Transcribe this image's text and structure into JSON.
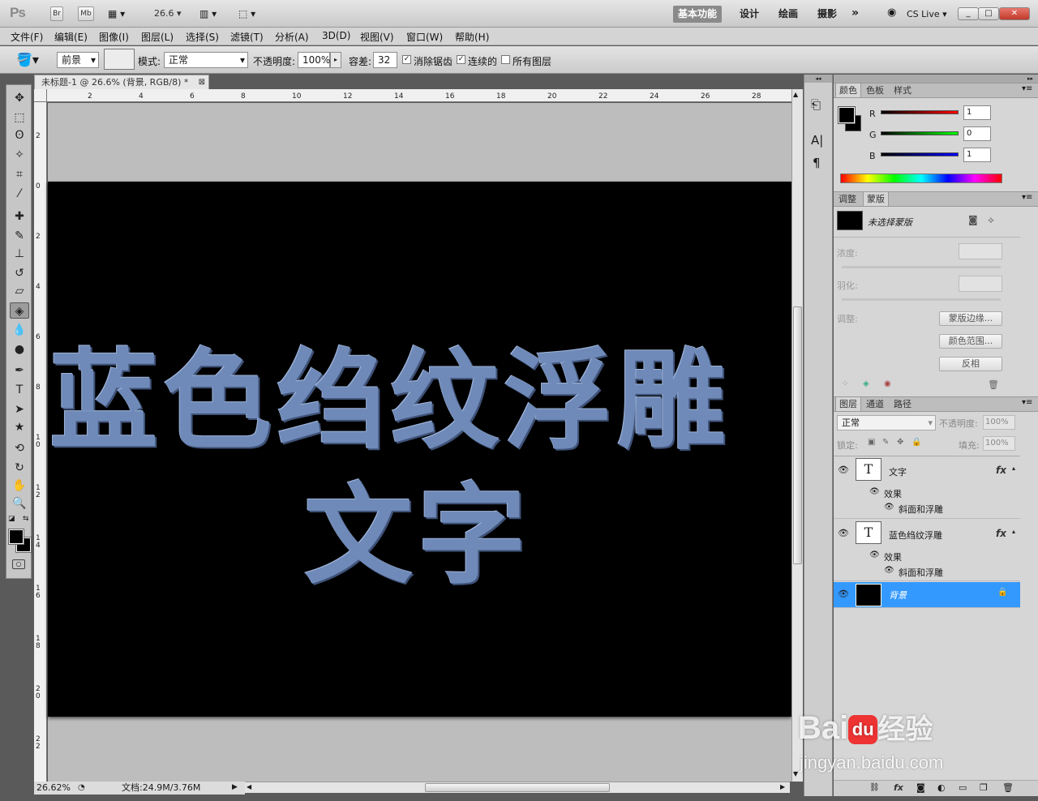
{
  "app": {
    "logo": "Ps",
    "bridge": "Br",
    "minibridge": "Mb",
    "zoom": "26.6"
  },
  "workspaces": [
    "基本功能",
    "设计",
    "绘画",
    "摄影"
  ],
  "cs_live": "CS Live",
  "window_controls": [
    "_",
    "□",
    "✕"
  ],
  "menu": [
    "文件(F)",
    "编辑(E)",
    "图像(I)",
    "图层(L)",
    "选择(S)",
    "滤镜(T)",
    "分析(A)",
    "3D(D)",
    "视图(V)",
    "窗口(W)",
    "帮助(H)"
  ],
  "options": {
    "fill_source": "前景",
    "mode_label": "模式:",
    "mode_value": "正常",
    "opacity_label": "不透明度:",
    "opacity_value": "100%",
    "tolerance_label": "容差:",
    "tolerance_value": "32",
    "antialias_label": "消除锯齿",
    "contiguous_label": "连续的",
    "all_layers_label": "所有图层"
  },
  "document": {
    "tab_title": "未标题-1 @ 26.6% (背景, RGB/8) *",
    "canvas_line1": "蓝色绉纹浮雕",
    "canvas_line2": "文字",
    "ruler_h": [
      "2",
      "4",
      "6",
      "8",
      "10",
      "12",
      "14",
      "16",
      "18",
      "20",
      "22",
      "24",
      "26",
      "28"
    ],
    "ruler_v": [
      "2",
      "0",
      "2",
      "4",
      "6",
      "8",
      "1 0",
      "1 2",
      "1 4",
      "1 6",
      "1 8",
      "2 0",
      "2 2"
    ],
    "zoom_status": "26.62%",
    "doc_size": "文档:24.9M/3.76M"
  },
  "color_panel": {
    "tabs": [
      "颜色",
      "色板",
      "样式"
    ],
    "r_label": "R",
    "g_label": "G",
    "b_label": "B",
    "r_value": "1",
    "g_value": "0",
    "b_value": "1"
  },
  "masks_panel": {
    "tabs": [
      "调整",
      "蒙版"
    ],
    "title": "未选择蒙版",
    "density_label": "浓度:",
    "feather_label": "羽化:",
    "refine_label": "调整:",
    "btn_mask_edge": "蒙版边缘...",
    "btn_color_range": "颜色范围...",
    "btn_invert": "反相"
  },
  "layers_panel": {
    "tabs": [
      "图层",
      "通道",
      "路径"
    ],
    "blend_mode": "正常",
    "opacity_label": "不透明度:",
    "opacity_value": "100%",
    "lock_label": "锁定:",
    "fill_label": "填充:",
    "fill_value": "100%",
    "layers": [
      {
        "name": "文字",
        "thumb": "T",
        "effects_label": "效果",
        "effect": "斜面和浮雕"
      },
      {
        "name": "蓝色绉纹浮雕",
        "thumb": "T",
        "effects_label": "效果",
        "effect": "斜面和浮雕"
      },
      {
        "name": "背景"
      }
    ]
  },
  "watermark": {
    "line1": "Bai",
    "line2": "du",
    "line3": "经验",
    "url": "jingyan.baidu.com"
  },
  "colors": {
    "accent_selection": "#3399ff",
    "text_blue": "#6f8ab8",
    "canvas_bg": "#000000"
  }
}
